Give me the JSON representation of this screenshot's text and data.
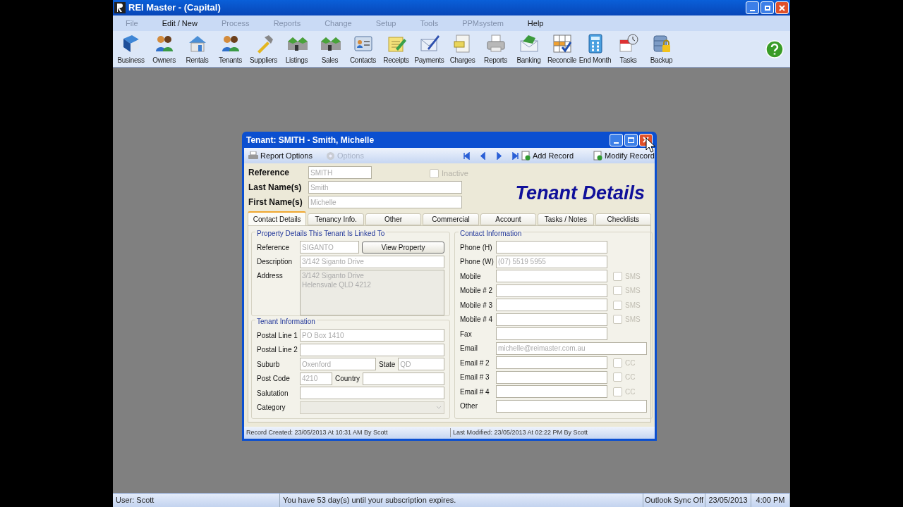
{
  "window": {
    "title": "REI Master - (Capital)"
  },
  "menu": [
    {
      "label": "File",
      "disabled": true
    },
    {
      "label": "Edit / New",
      "disabled": false
    },
    {
      "label": "Process",
      "disabled": true
    },
    {
      "label": "Reports",
      "disabled": true
    },
    {
      "label": "Change",
      "disabled": true
    },
    {
      "label": "Setup",
      "disabled": true
    },
    {
      "label": "Tools",
      "disabled": true
    },
    {
      "label": "PPMsystem",
      "disabled": true
    },
    {
      "label": "Help",
      "disabled": false
    }
  ],
  "toolbar": [
    {
      "label": "Business"
    },
    {
      "label": "Owners"
    },
    {
      "label": "Rentals"
    },
    {
      "label": "Tenants"
    },
    {
      "label": "Suppliers"
    },
    {
      "label": "Listings"
    },
    {
      "label": "Sales"
    },
    {
      "label": "Contacts"
    },
    {
      "label": "Receipts"
    },
    {
      "label": "Payments"
    },
    {
      "label": "Charges"
    },
    {
      "label": "Reports"
    },
    {
      "label": "Banking"
    },
    {
      "label": "Reconcile"
    },
    {
      "label": "End Month"
    },
    {
      "label": "Tasks"
    },
    {
      "label": "Backup"
    }
  ],
  "dialog": {
    "title": "Tenant: SMITH - Smith, Michelle",
    "actions": [
      {
        "label": "Report Options",
        "disabled": false
      },
      {
        "label": "Options",
        "disabled": true
      }
    ],
    "record_actions": [
      {
        "label": "Add Record"
      },
      {
        "label": "Modify Record"
      }
    ],
    "heading": "Tenant Details",
    "header_fields": [
      {
        "label": "Reference",
        "value": "SMITH",
        "kind": "short"
      },
      {
        "label": "Last Name(s)",
        "value": "Smith",
        "kind": "long"
      },
      {
        "label": "First Name(s)",
        "value": "Michelle",
        "kind": "long"
      }
    ],
    "inactive": {
      "label": "Inactive",
      "checked": false
    },
    "tabs": [
      {
        "label": "Contact Details",
        "selected": true
      },
      {
        "label": "Tenancy Info.",
        "selected": false
      },
      {
        "label": "Other",
        "selected": false
      },
      {
        "label": "Commercial",
        "selected": false
      },
      {
        "label": "Account",
        "selected": false
      },
      {
        "label": "Tasks / Notes",
        "selected": false
      },
      {
        "label": "Checklists",
        "selected": false
      }
    ],
    "property": {
      "title": "Property Details This Tenant Is Linked To",
      "reference_label": "Reference",
      "reference": "SIGANTO",
      "button": "View Property",
      "description_label": "Description",
      "description": "3/142 Siganto Drive",
      "address_label": "Address",
      "address_lines": [
        "3/142 Siganto Drive",
        "Helensvale QLD 4212"
      ]
    },
    "tenant_info": {
      "title": "Tenant Information",
      "rows": [
        {
          "kind": "text",
          "label": "Postal Line 1",
          "value": "PO Box 1410"
        },
        {
          "kind": "text",
          "label": "Postal Line 2"
        },
        {
          "kind": "pair",
          "label": "Suburb",
          "value": "Oxenford",
          "label2": "State",
          "value2": "QD"
        },
        {
          "kind": "pair",
          "label": "Post Code",
          "value": "4210",
          "label2": "Country"
        },
        {
          "kind": "text",
          "label": "Salutation"
        },
        {
          "kind": "select",
          "label": "Category"
        }
      ]
    },
    "contact_info": {
      "title": "Contact Information",
      "rows": [
        {
          "kind": "short",
          "label": "Phone (H)"
        },
        {
          "kind": "short",
          "label": "Phone (W)",
          "value": "(07) 5519 5955"
        },
        {
          "kind": "short",
          "label": "Mobile",
          "check": {
            "label": "SMS",
            "checked": false
          }
        },
        {
          "kind": "short",
          "label": "Mobile # 2",
          "check": {
            "label": "SMS",
            "checked": false
          }
        },
        {
          "kind": "short",
          "label": "Mobile # 3",
          "check": {
            "label": "SMS",
            "checked": false
          }
        },
        {
          "kind": "short",
          "label": "Mobile # 4",
          "check": {
            "label": "SMS",
            "checked": false
          }
        },
        {
          "kind": "short",
          "label": "Fax"
        },
        {
          "kind": "long",
          "label": "Email",
          "value": "michelle@reimaster.com.au"
        },
        {
          "kind": "short",
          "label": "Email # 2",
          "check": {
            "label": "CC",
            "checked": false
          }
        },
        {
          "kind": "short",
          "label": "Email # 3",
          "check": {
            "label": "CC",
            "checked": false
          }
        },
        {
          "kind": "short",
          "label": "Email # 4",
          "check": {
            "label": "CC",
            "checked": false
          }
        },
        {
          "kind": "long",
          "label": "Other"
        }
      ]
    },
    "created": "Record Created: 23/05/2013 At 10:31 AM  By Scott",
    "modified": "Last Modified: 23/05/2013 At 02:22 PM  By Scott"
  },
  "status_bar": [
    "User: Scott",
    "You have 53 day(s) until your subscription expires.",
    "Outlook Sync Off",
    "23/05/2013",
    "4:00 PM"
  ]
}
